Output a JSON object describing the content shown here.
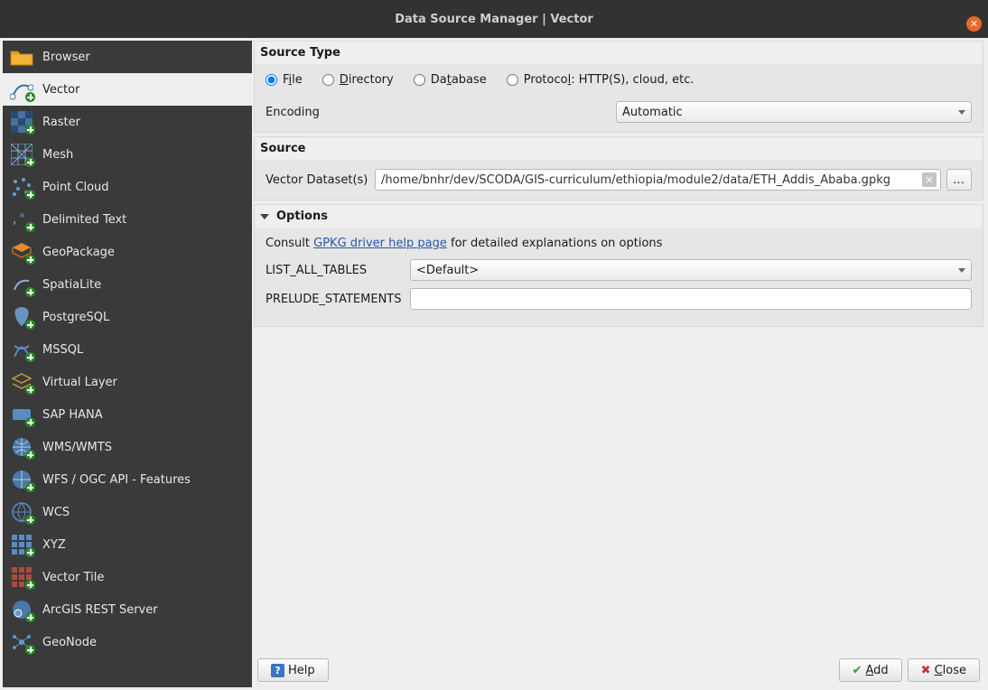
{
  "title": "Data Source Manager | Vector",
  "sidebar": {
    "items": [
      {
        "label": "Browser",
        "icon": "folder-icon"
      },
      {
        "label": "Vector",
        "icon": "vector-icon",
        "selected": true
      },
      {
        "label": "Raster",
        "icon": "raster-icon"
      },
      {
        "label": "Mesh",
        "icon": "mesh-icon"
      },
      {
        "label": "Point Cloud",
        "icon": "pointcloud-icon"
      },
      {
        "label": "Delimited Text",
        "icon": "delimited-icon"
      },
      {
        "label": "GeoPackage",
        "icon": "geopackage-icon"
      },
      {
        "label": "SpatiaLite",
        "icon": "spatialite-icon"
      },
      {
        "label": "PostgreSQL",
        "icon": "postgres-icon"
      },
      {
        "label": "MSSQL",
        "icon": "mssql-icon"
      },
      {
        "label": "Virtual Layer",
        "icon": "virtuallayer-icon"
      },
      {
        "label": "SAP HANA",
        "icon": "saphana-icon"
      },
      {
        "label": "WMS/WMTS",
        "icon": "wms-icon"
      },
      {
        "label": "WFS / OGC API - Features",
        "icon": "wfs-icon"
      },
      {
        "label": "WCS",
        "icon": "wcs-icon"
      },
      {
        "label": "XYZ",
        "icon": "xyz-icon"
      },
      {
        "label": "Vector Tile",
        "icon": "vectortile-icon"
      },
      {
        "label": "ArcGIS REST Server",
        "icon": "arcgis-icon"
      },
      {
        "label": "GeoNode",
        "icon": "geonode-icon"
      }
    ]
  },
  "source_type": {
    "heading": "Source Type",
    "options": [
      {
        "label": "File",
        "access": "i",
        "checked": true
      },
      {
        "label": "Directory",
        "access": "D",
        "checked": false
      },
      {
        "label": "Database",
        "access": "t",
        "checked": false
      },
      {
        "label": "Protocol: HTTP(S), cloud, etc.",
        "access": "l",
        "checked": false
      }
    ],
    "encoding_label": "Encoding",
    "encoding_value": "Automatic"
  },
  "source": {
    "heading": "Source",
    "dataset_label": "Vector Dataset(s)",
    "dataset_value": "/home/bnhr/dev/SCODA/GIS-curriculum/ethiopia/module2/data/ETH_Addis_Ababa.gpkg",
    "browse": "…"
  },
  "options": {
    "heading": "Options",
    "consult_prefix": "Consult ",
    "link_text": "GPKG driver help page",
    "consult_suffix": " for detailed explanations on options",
    "list_all_tables_label": "LIST_ALL_TABLES",
    "list_all_tables_value": "<Default>",
    "prelude_label": "PRELUDE_STATEMENTS",
    "prelude_value": ""
  },
  "buttons": {
    "help": "Help",
    "add": "Add",
    "close": "Close"
  }
}
